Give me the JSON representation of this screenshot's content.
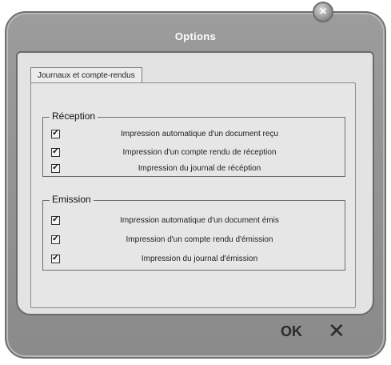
{
  "window": {
    "title": "Options",
    "close_glyph": "×"
  },
  "tabs": [
    {
      "label": "Journaux et compte-rendus",
      "selected": true
    }
  ],
  "groups": [
    {
      "title": "Réception",
      "options": [
        {
          "label": "Impression automatique d'un document reçu",
          "checked": true
        },
        {
          "label": "Impression  d'un compte rendu de réception",
          "checked": true
        },
        {
          "label": "Impression du journal de récéption",
          "checked": true
        }
      ]
    },
    {
      "title": "Emission",
      "options": [
        {
          "label": "Impression automatique d'un document émis",
          "checked": true
        },
        {
          "label": "Impression  d'un compte rendu d'émission",
          "checked": true
        },
        {
          "label": "Impression du journal d'émission",
          "checked": true
        }
      ]
    }
  ],
  "footer": {
    "ok_label": "OK",
    "cancel_glyph": "✕"
  },
  "icons": {
    "close": "close-icon",
    "checkbox": "checkbox-checked-icon"
  }
}
